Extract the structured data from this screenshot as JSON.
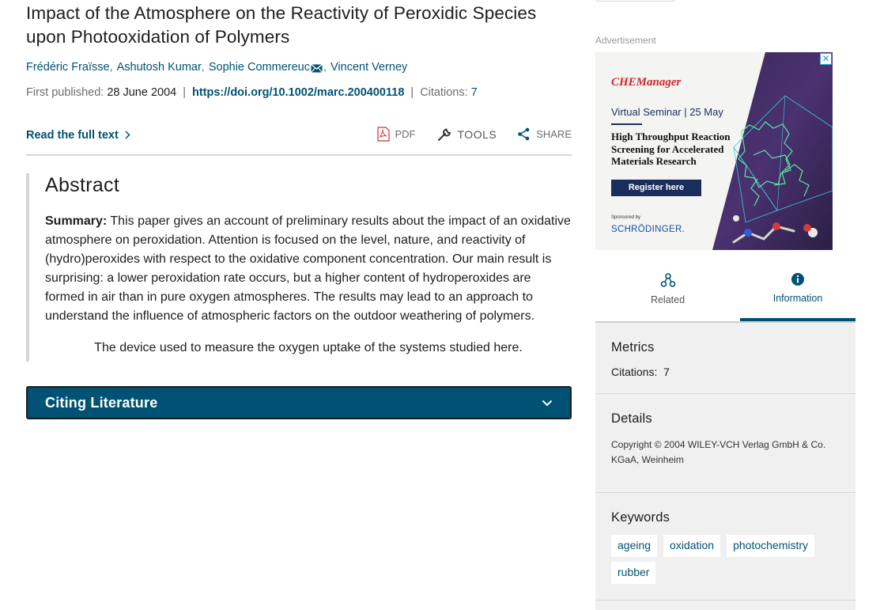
{
  "article": {
    "title": "Impact of the Atmosphere on the Reactivity of Peroxidic Species upon Photooxidation of Polymers",
    "authors": [
      "Frédéric Fraïsse",
      "Ashutosh Kumar",
      "Sophie Commereuc",
      "Vincent Verney"
    ],
    "published_label": "First published:",
    "published_date": "28 June 2004",
    "doi": "https://doi.org/10.1002/marc.200400118",
    "citations_label": "Citations:",
    "citations_value": "7"
  },
  "actions": {
    "read_full": "Read the full text",
    "pdf": "PDF",
    "tools": "TOOLS",
    "share": "SHARE"
  },
  "abstract": {
    "heading": "Abstract",
    "summary_label": "Summary:",
    "summary_text": " This paper gives an account of preliminary results about the impact of an oxidative atmosphere on peroxidation. Attention is focused on the level, nature, and reactivity of (hydro)peroxides with respect to the oxidative component concentration. Our main result is surprising: a lower peroxidation rate occurs, but a higher content of hydroperoxides are formed in air than in pure oxygen atmospheres. The results may lead to an approach to understand the influence of atmospheric factors on the outdoor weathering of polymers.",
    "caption": "The device used to measure the oxygen uptake of the systems studied here."
  },
  "citing": {
    "label": "Citing Literature"
  },
  "ad": {
    "label": "Advertisement",
    "brand": "CHEManager",
    "event": "Virtual Seminar | 25 May",
    "headline": "High Throughput Reaction Screening for Accelerated Materials Research",
    "register": "Register here",
    "sponsored": "Sponsored by",
    "sponsor": "SCHRÖDINGER."
  },
  "tabs": {
    "related": "Related",
    "information": "Information"
  },
  "info": {
    "metrics_heading": "Metrics",
    "metrics_citations": "Citations:  7",
    "details_heading": "Details",
    "copyright": "Copyright © 2004 WILEY-VCH Verlag GmbH & Co. KGaA, Weinheim",
    "keywords_heading": "Keywords",
    "keywords": [
      "ageing",
      "oxidation",
      "photochemistry",
      "rubber"
    ]
  },
  "colors": {
    "accent": "#005274",
    "ad_navy": "#1b2e5b",
    "ad_red": "#d0252c"
  },
  "icons": [
    "mail-icon",
    "chevron-right-icon",
    "pdf-icon",
    "wrench-icon",
    "share-icon",
    "chevron-down-icon",
    "close-icon",
    "related-icon",
    "info-icon"
  ]
}
